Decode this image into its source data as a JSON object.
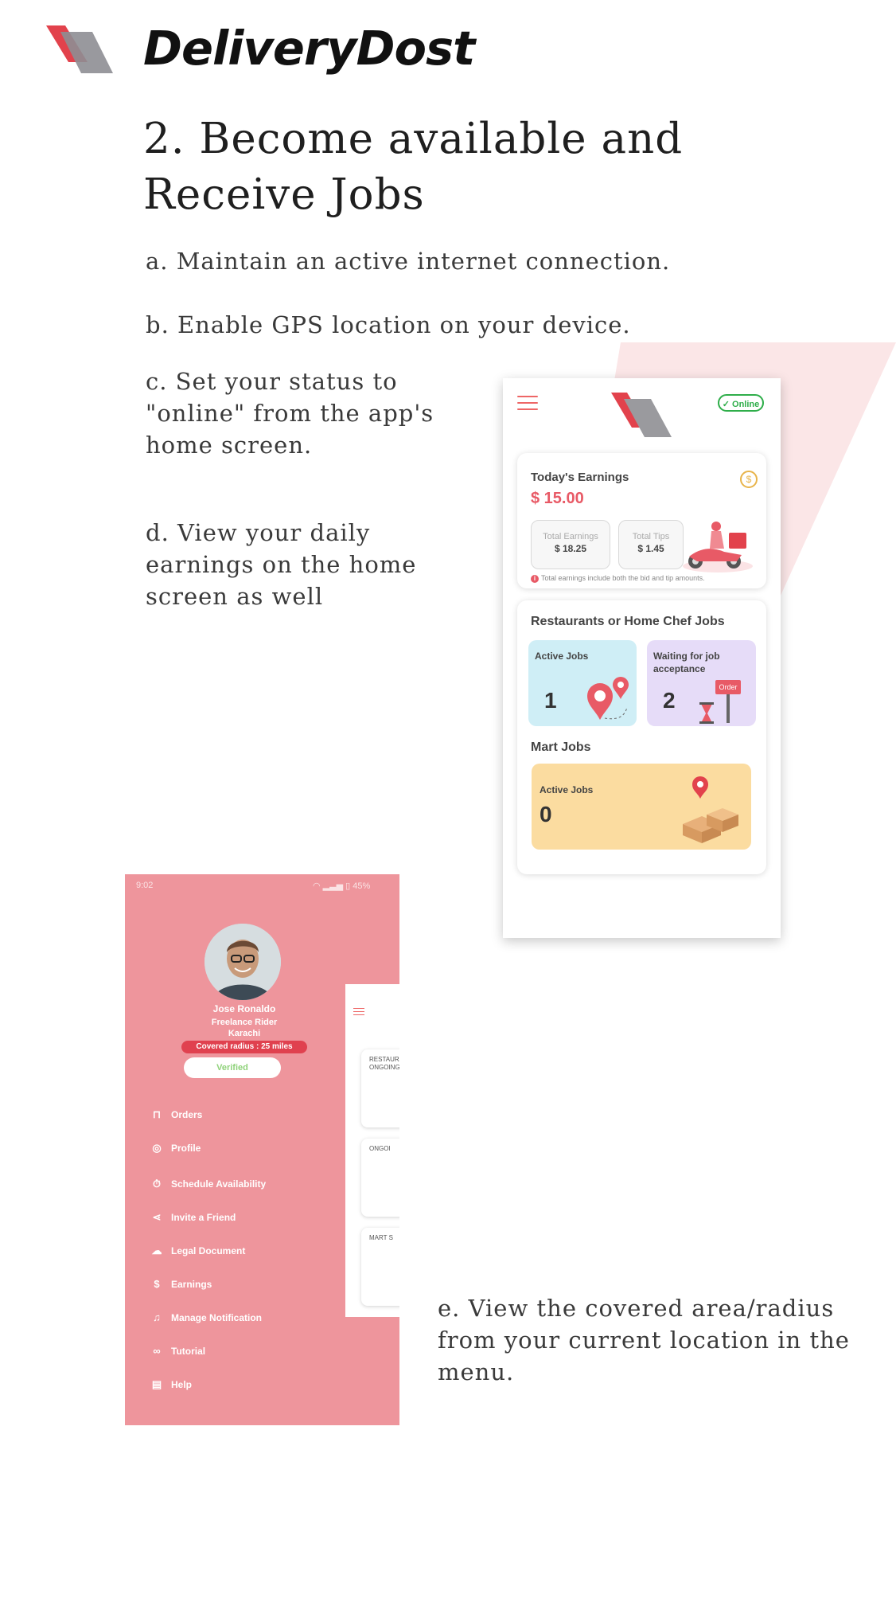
{
  "brand": {
    "name": "DeliveryDost",
    "logo_icon": "slanted-parallelogram-logo",
    "accent": "#e2424c"
  },
  "heading": "2. Become available and Receive Jobs",
  "steps": {
    "a": "a. Maintain an active internet connection.",
    "b": "b. Enable GPS location on your device.",
    "c": "c. Set your status to \"online\" from the app's home screen.",
    "d": "d. View your daily earnings on the home screen as well",
    "e": "e. View the covered area/radius from your current location in the menu."
  },
  "home_screen": {
    "menu_icon": "hamburger-icon",
    "status_label": "Online",
    "earnings": {
      "title": "Today's Earnings",
      "amount": "$ 15.00",
      "coin_icon": "dollar-coin-icon",
      "total_earnings_label": "Total Earnings",
      "total_earnings_value": "$ 18.25",
      "total_tips_label": "Total Tips",
      "total_tips_value": "$ 1.45",
      "note": "Total earnings include both the bid and tip amounts."
    },
    "jobs": {
      "title": "Restaurants or Home Chef Jobs",
      "active_label": "Active Jobs",
      "active_count": "1",
      "waiting_label": "Waiting for job acceptance",
      "waiting_count": "2",
      "order_sign": "Order",
      "mart_title": "Mart Jobs",
      "mart_active_label": "Active Jobs",
      "mart_active_count": "0"
    }
  },
  "menu_screen": {
    "status_time": "9:02",
    "battery": "45%",
    "profile": {
      "name": "Jose Ronaldo",
      "role": "Freelance Rider",
      "city": "Karachi",
      "radius": "Covered radius : 25 miles",
      "verified": "Verified"
    },
    "items": [
      {
        "label": "Orders",
        "icon": "shopping-bag-icon"
      },
      {
        "label": "Profile",
        "icon": "user-circle-icon"
      },
      {
        "label": "Schedule Availability",
        "icon": "timer-icon"
      },
      {
        "label": "Invite a Friend",
        "icon": "share-icon"
      },
      {
        "label": "Legal Document",
        "icon": "cloud-icon"
      },
      {
        "label": "Earnings",
        "icon": "dollar-circle-icon"
      },
      {
        "label": "Manage Notification",
        "icon": "bell-icon"
      },
      {
        "label": "Tutorial",
        "icon": "link-icon"
      },
      {
        "label": "Help",
        "icon": "document-icon"
      }
    ],
    "peek": {
      "card1": "RESTAURA\nONGOING",
      "card2": "ONGOI",
      "card3": "MART S"
    }
  }
}
